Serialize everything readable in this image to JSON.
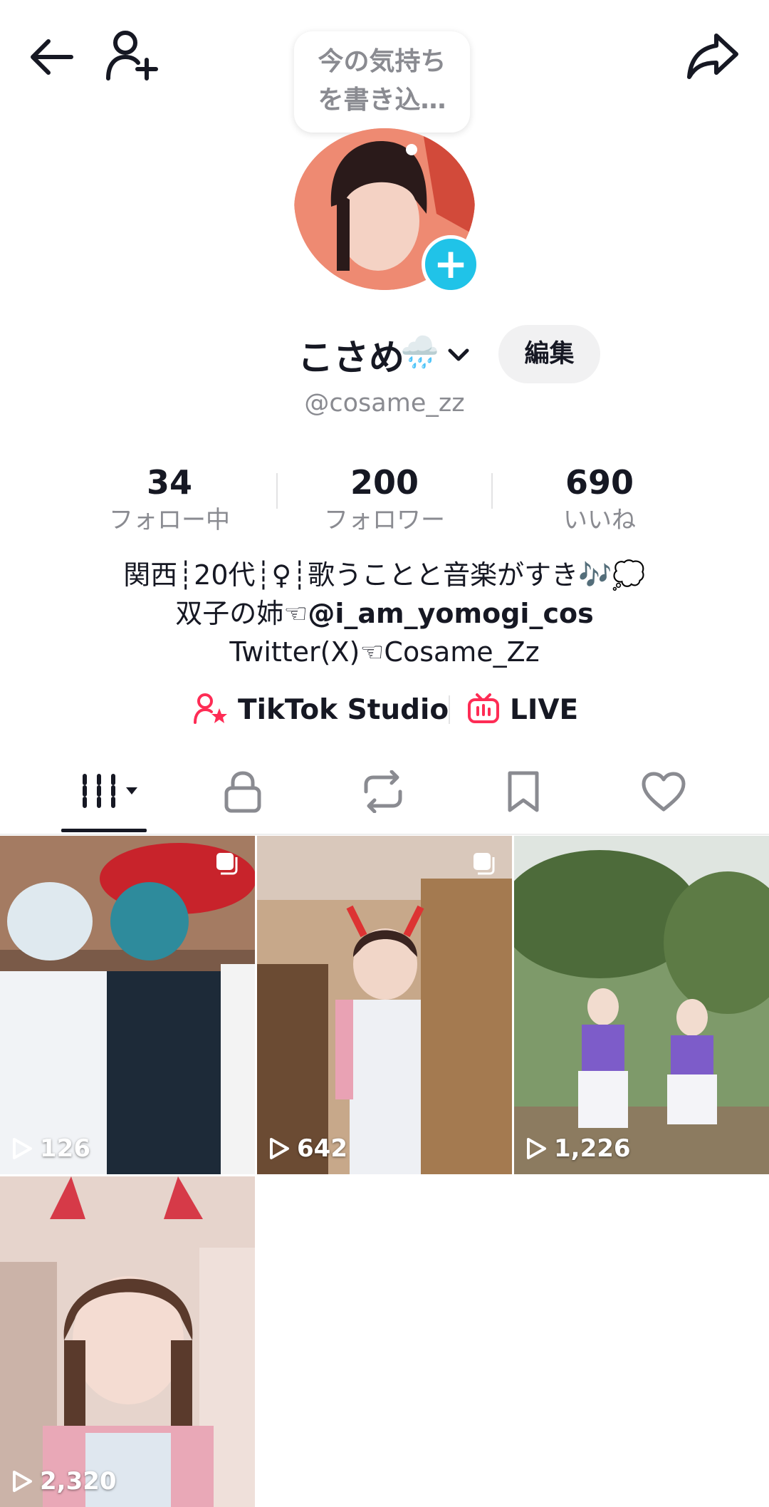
{
  "header": {
    "status_bubble": "今の気持ち\nを書き込…",
    "status_line1": "今の気持ち",
    "status_line2": "を書き込…"
  },
  "profile": {
    "display_name": "こさめ",
    "name_emoji": "🌧️",
    "edit_label": "編集",
    "username": "@cosame_zz"
  },
  "stats": [
    {
      "value": "34",
      "label": "フォロー中"
    },
    {
      "value": "200",
      "label": "フォロワー"
    },
    {
      "value": "690",
      "label": "いいね"
    }
  ],
  "bio": {
    "line1": "関西┊20代┊♀┊歌うことと音楽がすき🎶💭",
    "line2_prefix": "双子の姉☜",
    "line2_mention": "@i_am_yomogi_cos",
    "line3": "Twitter(X)☜Cosame_Zz"
  },
  "links": {
    "studio_label": "TikTok Studio",
    "live_label": "LIVE"
  },
  "tabs": [
    "videos",
    "private",
    "reposts",
    "favorites",
    "liked"
  ],
  "videos": [
    {
      "views": "126",
      "multi": true
    },
    {
      "views": "642",
      "multi": true
    },
    {
      "views": "1,226",
      "multi": false
    },
    {
      "views": "2,320",
      "multi": false
    }
  ],
  "colors": {
    "accent_cyan": "#20c3e8",
    "accent_pink": "#fe2c55",
    "text": "#161823",
    "muted": "#8a8b91"
  }
}
